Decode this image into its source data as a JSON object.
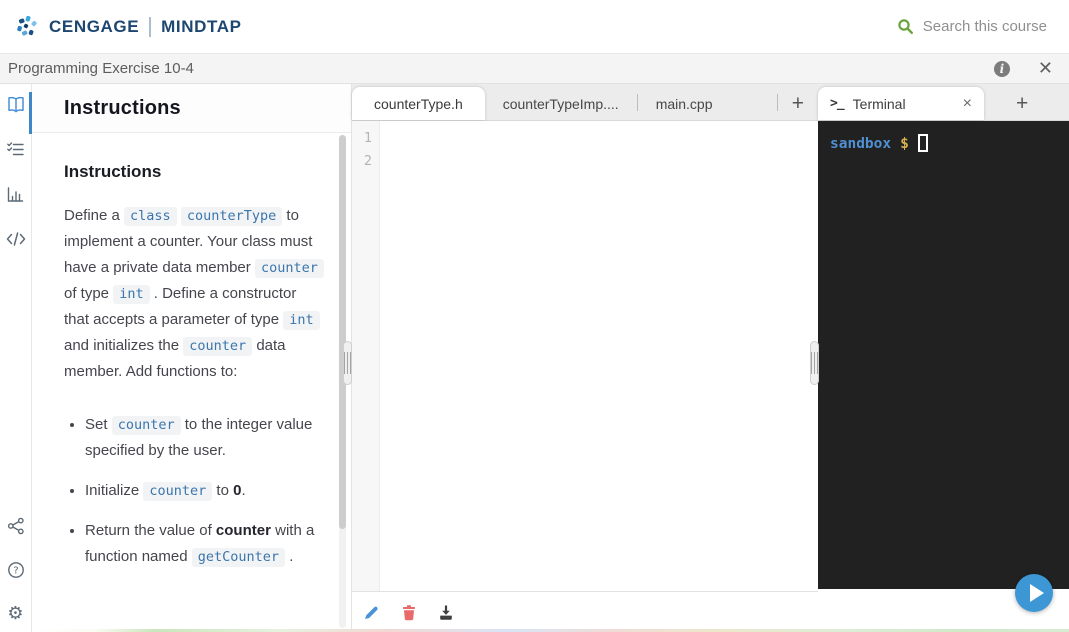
{
  "header": {
    "brand_primary": "CENGAGE",
    "brand_secondary": "MINDTAP",
    "search_placeholder": "Search this course"
  },
  "titlebar": {
    "title": "Programming Exercise 10-4"
  },
  "sidebar": {
    "items": [
      {
        "icon": "book-icon",
        "active": true
      },
      {
        "icon": "checklist-icon",
        "active": false
      },
      {
        "icon": "bar-chart-icon",
        "active": false
      },
      {
        "icon": "code-icon",
        "active": false
      }
    ],
    "bottom_items": [
      {
        "icon": "share-icon"
      },
      {
        "icon": "help-icon"
      },
      {
        "icon": "settings-icon"
      }
    ]
  },
  "instructions": {
    "panel_title": "Instructions",
    "heading": "Instructions",
    "intro": [
      {
        "t": "Define a "
      },
      {
        "c": "class"
      },
      {
        "t": " "
      },
      {
        "c": "counterType"
      },
      {
        "t": " to implement a counter. Your class must have a private data member "
      },
      {
        "c": "counter"
      },
      {
        "t": " of type "
      },
      {
        "c": "int"
      },
      {
        "t": " . Define a constructor that accepts a parameter of type "
      },
      {
        "c": "int"
      },
      {
        "t": " and initializes the "
      },
      {
        "c": "counter"
      },
      {
        "t": " data member. Add functions to:"
      }
    ],
    "bullets": [
      [
        {
          "t": "Set "
        },
        {
          "c": "counter"
        },
        {
          "t": " to the integer value specified by the user."
        }
      ],
      [
        {
          "t": "Initialize "
        },
        {
          "c": "counter"
        },
        {
          "t": " to "
        },
        {
          "b": "0"
        },
        {
          "t": "."
        }
      ],
      [
        {
          "t": "Return the value of "
        },
        {
          "b": "counter"
        },
        {
          "t": " with a function named "
        },
        {
          "c": "getCounter"
        },
        {
          "t": " ."
        }
      ]
    ]
  },
  "editor": {
    "tabs": [
      {
        "label": "counterType.h",
        "active": true
      },
      {
        "label": "counterTypeImp....",
        "active": false
      },
      {
        "label": "main.cpp",
        "active": false
      }
    ],
    "add_tab_label": "+",
    "line_numbers": [
      "1",
      "2"
    ],
    "toolbar": [
      {
        "name": "edit",
        "icon": "pencil-icon"
      },
      {
        "name": "delete",
        "icon": "trash-icon"
      },
      {
        "name": "download",
        "icon": "download-icon"
      }
    ]
  },
  "terminal": {
    "terminal_icon": ">_",
    "tab_label": "Terminal",
    "close_label": "×",
    "add_tab_label": "+",
    "prompt_user": "sandbox",
    "prompt_symbol": "$"
  },
  "colors": {
    "brand_navy": "#1d4670",
    "search_green": "#6ba23c",
    "accent_blue": "#3d97d4",
    "active_rail_blue": "#3d87c9",
    "inline_code_text": "#3a76ad",
    "inline_code_bg": "#f2f3f5",
    "terminal_bg": "#212121",
    "prompt_user_color": "#4f90d2",
    "prompt_symbol_color": "#d8b14f",
    "edit_icon_color": "#4a93d8",
    "delete_icon_color": "#e96a6a"
  }
}
